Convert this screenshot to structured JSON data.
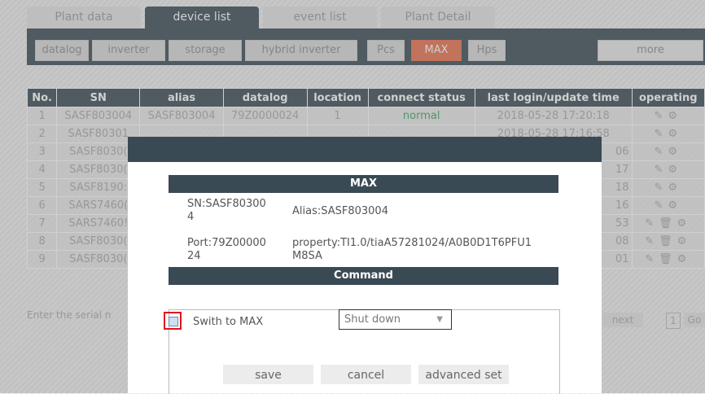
{
  "tabs": [
    "Plant data",
    "device list",
    "event list",
    "Plant Detail"
  ],
  "subtabs": [
    "datalog",
    "inverter",
    "storage",
    "hybrid inverter",
    "Pcs",
    "MAX",
    "Hps"
  ],
  "more_label": "more",
  "table": {
    "headers": [
      "No.",
      "SN",
      "alias",
      "datalog",
      "location",
      "connect status",
      "last login/update time",
      "operating"
    ],
    "rows": [
      [
        "1",
        "SASF803004",
        "SASF803004",
        "79Z0000024",
        "1",
        "normal",
        "2018-05-28 17:20:18"
      ],
      [
        "2",
        "SASF80301",
        "",
        "",
        "",
        "",
        ""
      ],
      [
        "3",
        "SASF8030(",
        "",
        "",
        "",
        "",
        ""
      ],
      [
        "4",
        "SASF8030(",
        "",
        "",
        "",
        "",
        ""
      ],
      [
        "5",
        "SASF8190:",
        "",
        "",
        "",
        "",
        ""
      ],
      [
        "6",
        "SARS7460(",
        "",
        "",
        "",
        "",
        ""
      ],
      [
        "7",
        "SARS7460!",
        "",
        "",
        "",
        "",
        ""
      ],
      [
        "8",
        "SASF8030(",
        "",
        "",
        "",
        "",
        ""
      ],
      [
        "9",
        "SASF8030(",
        "",
        "",
        "",
        "",
        ""
      ]
    ],
    "row2_partial_time": "2018-05-28 17:16:58",
    "time_suffixes": [
      "06",
      "17",
      "18",
      "16",
      "53",
      "08",
      "01"
    ]
  },
  "serial_placeholder": "Enter the serial n",
  "pager": {
    "next": "next",
    "page": "1",
    "go": "Go"
  },
  "modal": {
    "title": "MAX",
    "sn_label": "SN:SASF80300",
    "sn_cont": "4",
    "alias": "Alias:SASF803004",
    "port_label": "Port:79Z00000",
    "port_cont": "24",
    "property": "property:TI1.0/tiaA57281024/A0B0D1T6PFU1",
    "property_cont": "M8SA",
    "command_title": "Command",
    "switch_label": "Swith to MAX",
    "select_value": "Shut down",
    "save": "save",
    "cancel": "cancel",
    "advanced": "advanced set"
  },
  "colors": {
    "header": "#3a4a55",
    "accent": "#e8704e",
    "status_ok": "#3aa35c",
    "highlight": "#e0141c"
  }
}
